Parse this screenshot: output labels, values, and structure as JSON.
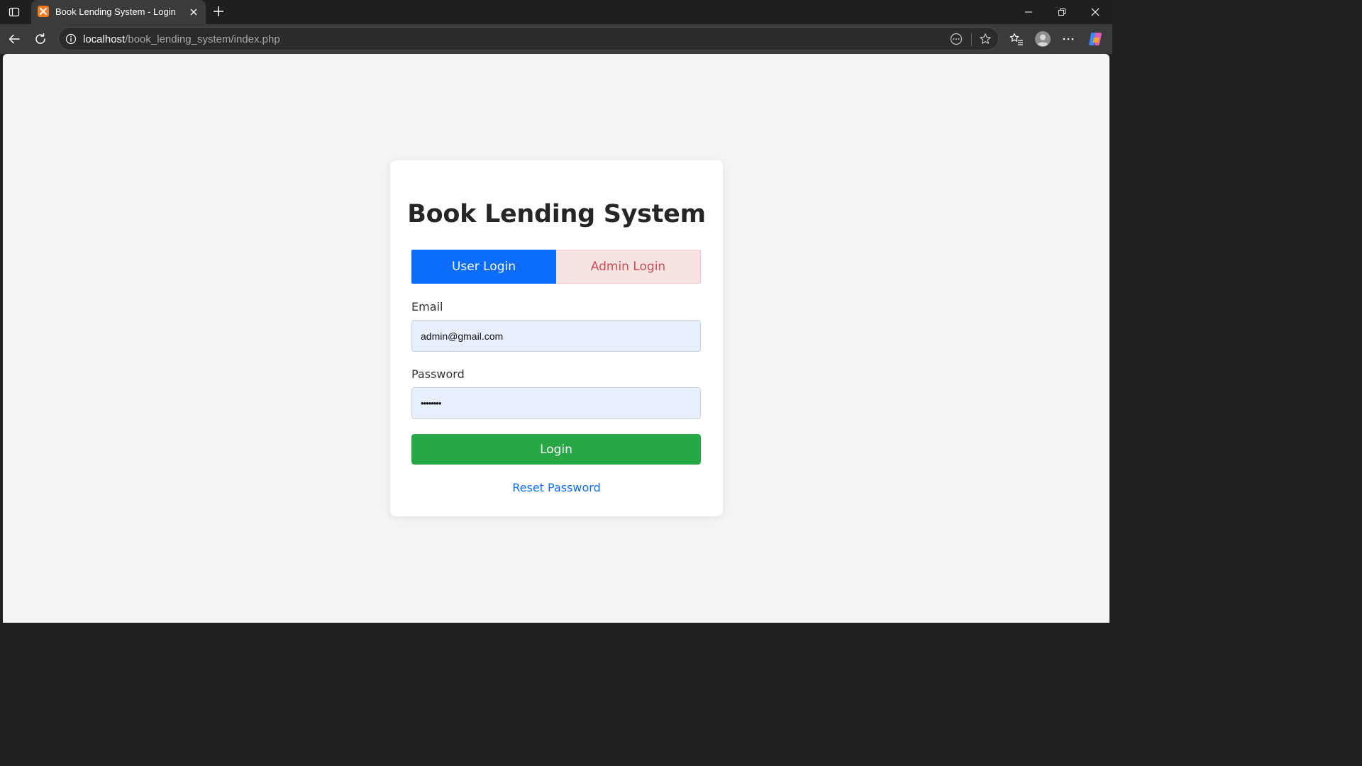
{
  "browser": {
    "tab_title": "Book Lending System - Login",
    "url_host": "localhost",
    "url_path": "/book_lending_system/index.php"
  },
  "page": {
    "heading": "Book Lending System",
    "tabs": {
      "user_label": "User Login",
      "admin_label": "Admin Login",
      "active": "user"
    },
    "email": {
      "label": "Email",
      "value": "admin@gmail.com"
    },
    "password": {
      "label": "Password",
      "masked_value": "••••••••"
    },
    "login_label": "Login",
    "reset_label": "Reset Password"
  },
  "colors": {
    "primary": "#0d6efd",
    "success": "#28a745",
    "danger_text": "#d14a54",
    "input_bg": "#e8f0fe"
  }
}
